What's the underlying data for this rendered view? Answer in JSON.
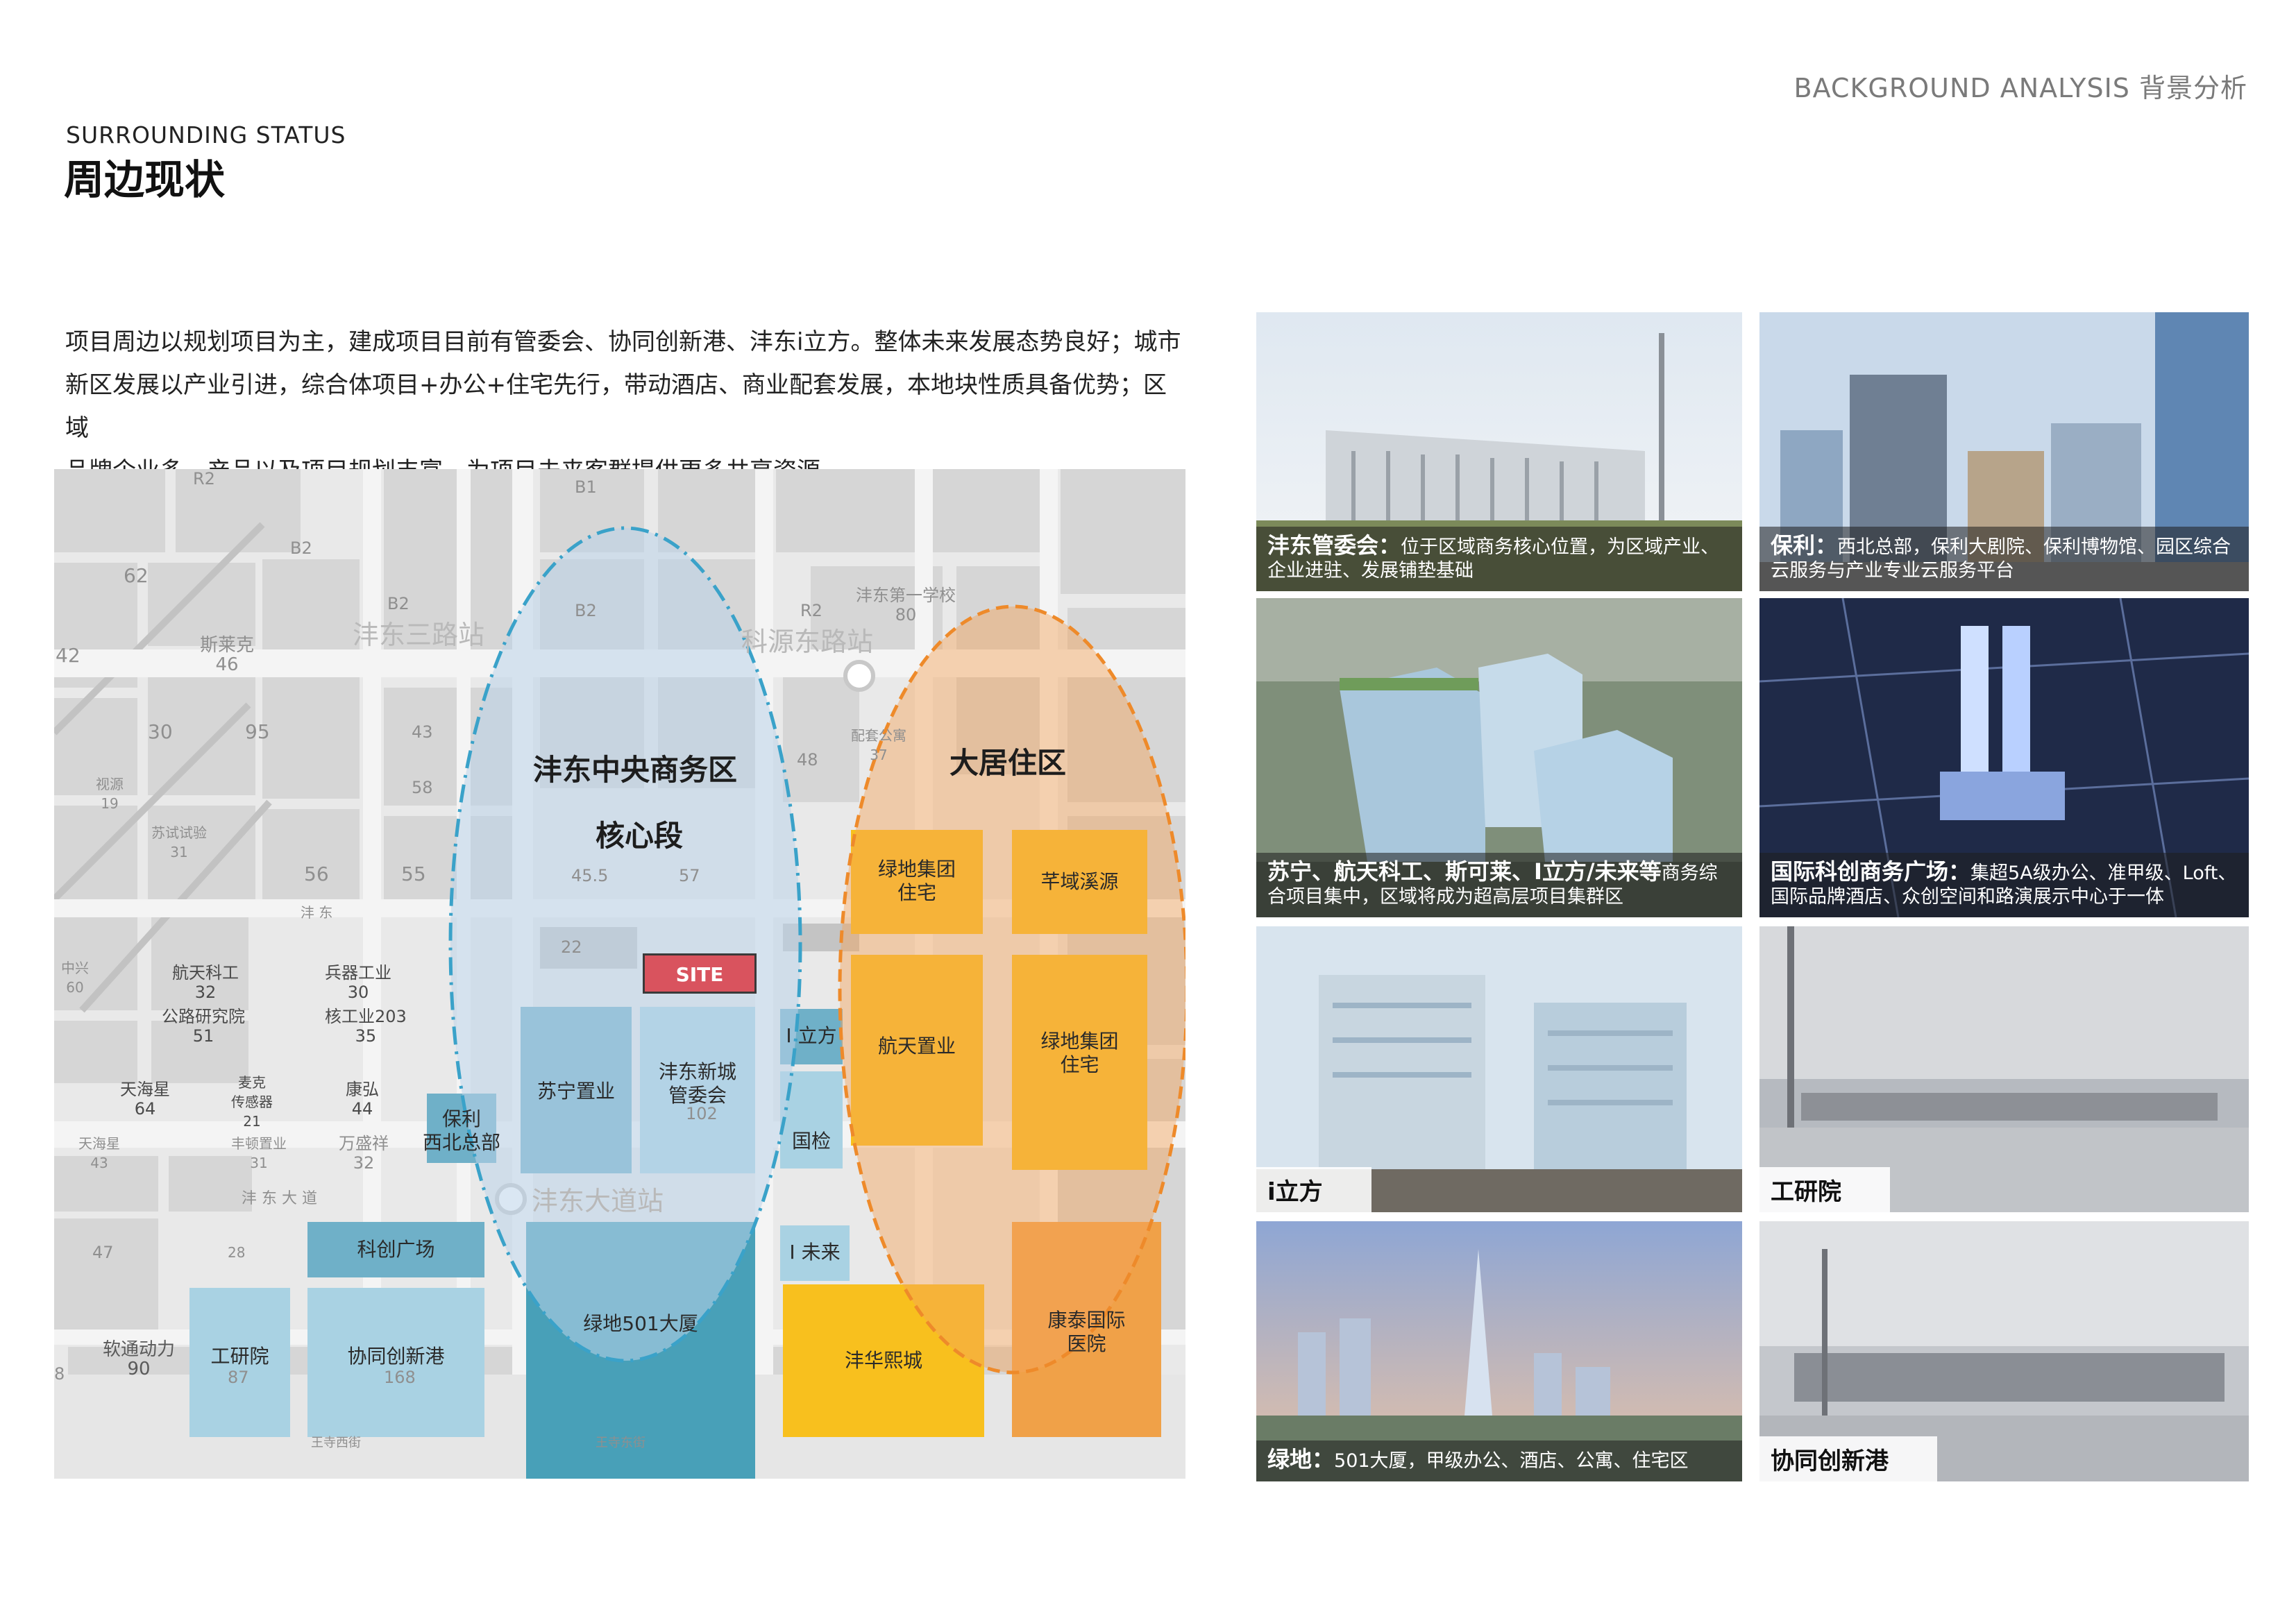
{
  "header": {
    "right_title": "BACKGROUND ANALYSIS 背景分析"
  },
  "section": {
    "subtitle_en": "SURROUNDING STATUS",
    "title_cn": "周边现状"
  },
  "intro": {
    "line1": "项目周边以规划项目为主，建成项目目前有管委会、协同创新港、沣东i立方。整体未来发展态势良好；城市",
    "line2": "新区发展以产业引进，综合体项目+办公+住宅先行，带动酒店、商业配套发展，本地块性质具备优势；区域",
    "line3": "品牌企业多、产品以及项目规划丰富，为项目未来客群提供更多共享资源。"
  },
  "map": {
    "zone_cbd_line1": "沣东中央商务区",
    "zone_cbd_line2": "核心段",
    "zone_residential": "大居住区",
    "site_label": "SITE",
    "stations": [
      "沣东三路站",
      "科源东路站",
      "沣东大道站"
    ],
    "blocks": {
      "baoli": "保利\n西北总部",
      "suning": "苏宁置业",
      "guanweihui": "沣东新城\n管委会",
      "ilifang": "I 立方",
      "guojian": "国检",
      "kechuang": "科创广场",
      "iweilai": "I 未来",
      "gongyanyuan": "工研院",
      "xietong": "协同创新港",
      "lvdi501": "绿地501大厦",
      "lvdi_res1": "绿地集团\n住宅",
      "yangyu": "芊域溪源",
      "hangtian": "航天置业",
      "lvdi_res2": "绿地集团\n住宅",
      "fenghua": "沣华熙城",
      "kangtai": "康泰国际\n医院"
    },
    "grey_labels": {
      "r2a": "R2",
      "b1": "B1",
      "b2a": "B2",
      "b2b": "B2",
      "b2c": "B2",
      "r2b": "R2",
      "n62": "62",
      "sikeke": "斯莱克\n46",
      "n42": "42",
      "n30": "30",
      "n95": "95",
      "n43": "43",
      "n58": "58",
      "shipin": "视源\n19",
      "sushi": "苏试试验\n31",
      "n56": "56",
      "n55": "55",
      "n455": "45.5",
      "n57": "57",
      "zhongxing": "中兴\n60",
      "hangtiankg": "航天科工\n32",
      "bingqi": "兵器工业\n30",
      "gonglu": "公路研究院\n51",
      "hegongye": "核工业203\n35",
      "tianhaixing": "天海星\n64",
      "maike": "麦克\n传感器\n21",
      "kanghong": "康弘\n44",
      "tianhai2": "天海星\n43",
      "fenghui": "丰顿置业\n31",
      "wansheng": "万盛祥\n32",
      "n47": "47",
      "n28": "28",
      "ruantong": "软通动力\n90",
      "n87": "87",
      "n168": "168",
      "n22": "22",
      "n102": "102",
      "n80": "沣东第一学校\n80",
      "n48": "48",
      "n8": "8",
      "peitao": "配套公寓\n37"
    },
    "road_labels": {
      "fengdong": "沣 东",
      "fengdongdadao": "沣 东 大 道",
      "wangsi_w": "王寺西街",
      "wangsi_e": "王寺东街",
      "dadao_v": "沣 东 大 道"
    }
  },
  "photos": [
    {
      "name": "沣东管委会：",
      "desc": "位于区域商务核心位置，为区域产业、企业进驻、发展铺垫基础",
      "style": "caption"
    },
    {
      "name": "保利：",
      "desc": "西北总部，保利大剧院、保利博物馆、园区综合云服务与产业专业云服务平台",
      "style": "caption"
    },
    {
      "name": "苏宁、航天科工、斯可莱、I立方/未来等",
      "desc": "商务综合项目集中，区域将成为超高层项目集群区",
      "style": "caption"
    },
    {
      "name": "国际科创商务广场：",
      "desc": "集超5A级办公、准甲级、Loft、国际品牌酒店、众创空间和路演展示中心于一体",
      "style": "caption"
    },
    {
      "name": "i立方",
      "desc": "",
      "style": "tag"
    },
    {
      "name": "工研院",
      "desc": "",
      "style": "tag"
    },
    {
      "name": "绿地：",
      "desc": "501大厦，甲级办公、酒店、公寓、住宅区",
      "style": "caption"
    },
    {
      "name": "协同创新港",
      "desc": "",
      "style": "tag"
    }
  ],
  "colors": {
    "teal": "#6fb0c8",
    "light_blue": "#a9d2e3",
    "yellow": "#f8c01e",
    "orange": "#f0a148",
    "site_red": "#d9535e"
  }
}
